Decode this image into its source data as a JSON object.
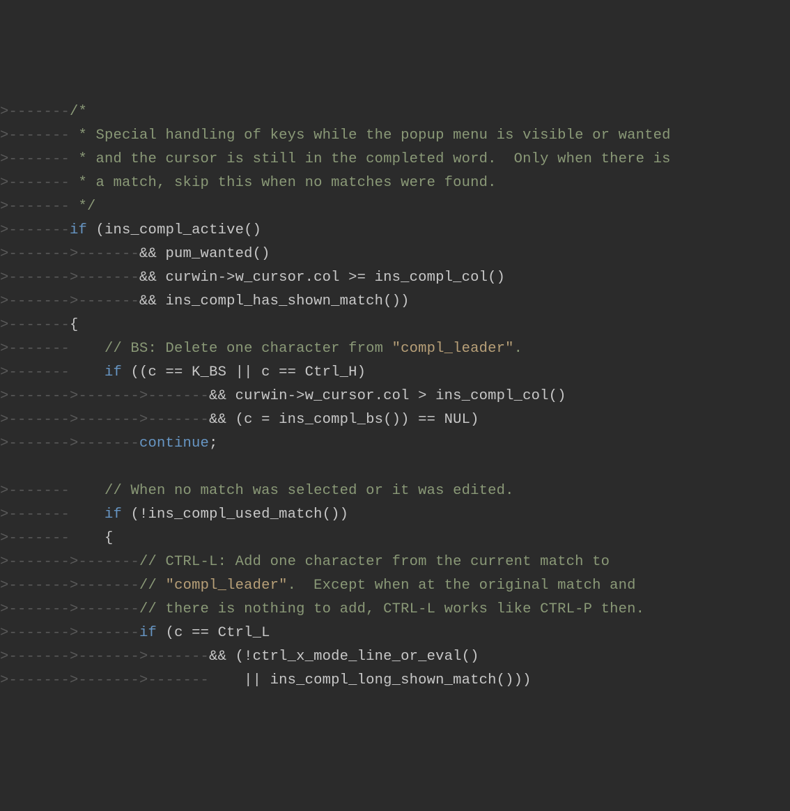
{
  "code": {
    "lines": [
      {
        "ws": ">-------",
        "segments": [
          {
            "cls": "comment",
            "text": "/*"
          }
        ]
      },
      {
        "ws": ">------- ",
        "segments": [
          {
            "cls": "comment",
            "text": "* Special handling of keys while the popup menu is visible or wanted"
          }
        ]
      },
      {
        "ws": ">------- ",
        "segments": [
          {
            "cls": "comment",
            "text": "* and the cursor is still in the completed word.  Only when there is"
          }
        ]
      },
      {
        "ws": ">------- ",
        "segments": [
          {
            "cls": "comment",
            "text": "* a match, skip this when no matches were found."
          }
        ]
      },
      {
        "ws": ">------- ",
        "segments": [
          {
            "cls": "comment",
            "text": "*/"
          }
        ]
      },
      {
        "ws": ">-------",
        "segments": [
          {
            "cls": "keyword",
            "text": "if"
          },
          {
            "cls": "ident",
            "text": " (ins_compl_active()"
          }
        ]
      },
      {
        "ws": ">------->-------",
        "segments": [
          {
            "cls": "ident",
            "text": "&& pum_wanted()"
          }
        ]
      },
      {
        "ws": ">------->-------",
        "segments": [
          {
            "cls": "ident",
            "text": "&& curwin->w_cursor.col >= ins_compl_col()"
          }
        ]
      },
      {
        "ws": ">------->-------",
        "segments": [
          {
            "cls": "ident",
            "text": "&& ins_compl_has_shown_match())"
          }
        ]
      },
      {
        "ws": ">-------",
        "segments": [
          {
            "cls": "ident",
            "text": "{"
          }
        ]
      },
      {
        "ws": ">-------    ",
        "segments": [
          {
            "cls": "comment",
            "text": "// BS: Delete one character from "
          },
          {
            "cls": "string-lit",
            "text": "\"compl_leader\""
          },
          {
            "cls": "comment",
            "text": "."
          }
        ]
      },
      {
        "ws": ">-------    ",
        "segments": [
          {
            "cls": "keyword",
            "text": "if"
          },
          {
            "cls": "ident",
            "text": " ((c == K_BS || c == Ctrl_H)"
          }
        ]
      },
      {
        "ws": ">------->------->-------",
        "segments": [
          {
            "cls": "ident",
            "text": "&& curwin->w_cursor.col > ins_compl_col()"
          }
        ]
      },
      {
        "ws": ">------->------->-------",
        "segments": [
          {
            "cls": "ident",
            "text": "&& (c = ins_compl_bs()) == NUL)"
          }
        ]
      },
      {
        "ws": ">------->-------",
        "segments": [
          {
            "cls": "keyword",
            "text": "continue"
          },
          {
            "cls": "semi",
            "text": ";"
          }
        ]
      },
      {
        "ws": "",
        "segments": []
      },
      {
        "ws": ">-------    ",
        "segments": [
          {
            "cls": "comment",
            "text": "// When no match was selected or it was edited."
          }
        ]
      },
      {
        "ws": ">-------    ",
        "segments": [
          {
            "cls": "keyword",
            "text": "if"
          },
          {
            "cls": "ident",
            "text": " (!ins_compl_used_match())"
          }
        ]
      },
      {
        "ws": ">-------    ",
        "segments": [
          {
            "cls": "ident",
            "text": "{"
          }
        ]
      },
      {
        "ws": ">------->-------",
        "segments": [
          {
            "cls": "comment",
            "text": "// CTRL-L: Add one character from the current match to"
          }
        ]
      },
      {
        "ws": ">------->-------",
        "segments": [
          {
            "cls": "comment",
            "text": "// "
          },
          {
            "cls": "string-lit",
            "text": "\"compl_leader\""
          },
          {
            "cls": "comment",
            "text": ".  Except when at the original match and"
          }
        ]
      },
      {
        "ws": ">------->-------",
        "segments": [
          {
            "cls": "comment",
            "text": "// there is nothing to add, CTRL-L works like CTRL-P then."
          }
        ]
      },
      {
        "ws": ">------->-------",
        "segments": [
          {
            "cls": "keyword",
            "text": "if"
          },
          {
            "cls": "ident",
            "text": " (c == Ctrl_L"
          }
        ]
      },
      {
        "ws": ">------->------->-------",
        "segments": [
          {
            "cls": "ident",
            "text": "&& (!ctrl_x_mode_line_or_eval()"
          }
        ]
      },
      {
        "ws": ">------->------->-------    ",
        "segments": [
          {
            "cls": "ident",
            "text": "|| ins_compl_long_shown_match()))"
          }
        ]
      }
    ]
  }
}
